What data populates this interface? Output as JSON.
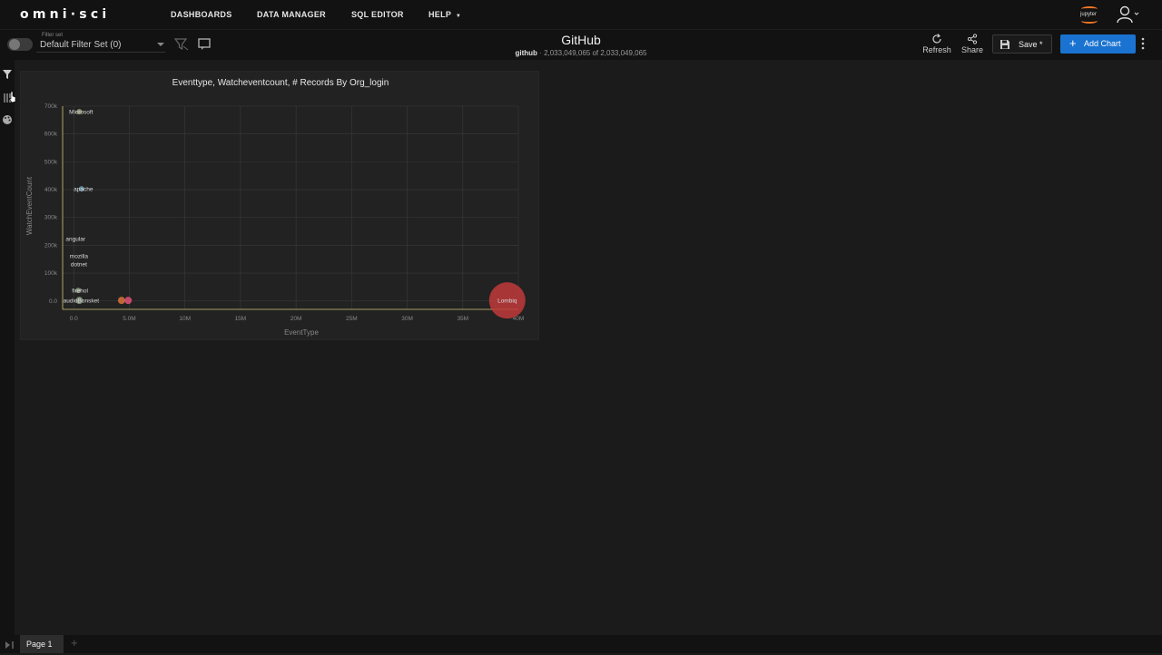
{
  "app": {
    "logo_text": "omni·sci",
    "nav": [
      "DASHBOARDS",
      "DATA MANAGER",
      "SQL EDITOR",
      "HELP"
    ],
    "jupyter_label": "jupyter"
  },
  "toolbar": {
    "filter_set_label": "Filter set",
    "filter_set_value": "Default Filter Set (0)",
    "dashboard_title": "GitHub",
    "table_name": "github",
    "record_count": "2,033,049,065 of 2,033,049,065",
    "refresh_label": "Refresh",
    "share_label": "Share",
    "save_label": "Save *",
    "add_chart_label": "Add Chart"
  },
  "icons": {
    "filter_toggle": "toggle-icon",
    "filter_clear": "filter-clear-icon",
    "comment": "comment-icon",
    "refresh": "refresh-icon",
    "share": "share-icon",
    "save": "floppy-icon",
    "add": "plus-icon",
    "more": "kebab-icon",
    "user": "user-icon",
    "sidebar_filter": "filter-icon",
    "sidebar_params": "sliders-icon",
    "sidebar_theme": "palette-icon"
  },
  "colors": {
    "accent": "#1a73d0",
    "jupyter_orange": "#f37726",
    "bubble_large": "#c03a3a",
    "bubble_orange": "#d9733a",
    "bubble_pink": "#e0507a",
    "bubble_default": "#8a9a80",
    "axis_line": "#d4c878"
  },
  "chart_data": {
    "type": "scatter",
    "title": "Eventtype, Watcheventcount, # Records By Org_login",
    "xlabel": "EventType",
    "ylabel": "WatchEventCount",
    "x_ticks": [
      "0.0",
      "5.0M",
      "10M",
      "15M",
      "20M",
      "25M",
      "30M",
      "35M",
      "40M"
    ],
    "y_ticks": [
      "0.0",
      "100k",
      "200k",
      "300k",
      "400k",
      "500k",
      "600k",
      "700k"
    ],
    "xlim": [
      -1000000,
      40000000
    ],
    "ylim": [
      -30000,
      700000
    ],
    "grid": true,
    "points": [
      {
        "label": "Microsoft",
        "x": 500000,
        "y": 680000,
        "size": 3,
        "color": "#9aa37a"
      },
      {
        "label": "apache",
        "x": 700000,
        "y": 403000,
        "size": 3,
        "color": "#6a9ab0"
      },
      {
        "label": "angular",
        "x": 0,
        "y": 225000,
        "size": 0,
        "color": "#8a9a80"
      },
      {
        "label": "mozilla",
        "x": 300000,
        "y": 162000,
        "size": 0,
        "color": "#8a9a80"
      },
      {
        "label": "dotnet",
        "x": 300000,
        "y": 133000,
        "size": 0,
        "color": "#8a9a80"
      },
      {
        "label": "firehol",
        "x": 400000,
        "y": 38000,
        "size": 3,
        "color": "#8a9a80"
      },
      {
        "label": "audioBonsket",
        "x": 500000,
        "y": 2000,
        "size": 4,
        "color": "#8a9a80"
      },
      {
        "label": "",
        "x": 4300000,
        "y": 2000,
        "size": 4,
        "color": "#d9733a"
      },
      {
        "label": "",
        "x": 4900000,
        "y": 2000,
        "size": 4,
        "color": "#e0507a"
      },
      {
        "label": "Lombiq",
        "x": 39000000,
        "y": 2000,
        "size": 20,
        "color": "#c03a3a"
      }
    ]
  },
  "pages": {
    "current": "Page 1",
    "add_symbol": "+"
  }
}
